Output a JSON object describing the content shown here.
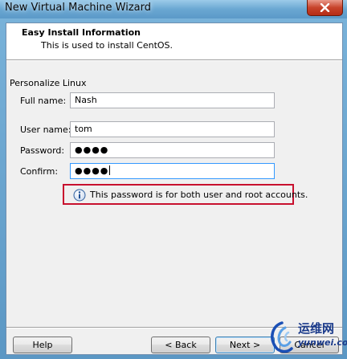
{
  "window": {
    "title": "New Virtual Machine Wizard"
  },
  "header": {
    "title": "Easy Install Information",
    "subtitle": "This is used to install CentOS."
  },
  "personalize": {
    "section_title": "Personalize Linux",
    "full_name_label": "Full name:",
    "full_name_value": "Nash",
    "user_name_label": "User name:",
    "user_name_value": "tom",
    "password_label": "Password:",
    "password_value": "●●●●",
    "confirm_label": "Confirm:",
    "confirm_value": "●●●●"
  },
  "hint": {
    "text": "This password is for both user and root accounts.",
    "highlight_color": "#c8102e"
  },
  "buttons": {
    "help": "Help",
    "back": "< Back",
    "next": "Next >",
    "cancel": "Cancel"
  },
  "watermark": {
    "line1": "运维网",
    "line2": "yunwei.com"
  },
  "icons": {
    "close": "close-icon",
    "info": "info-icon",
    "logo": "watermark-logo"
  }
}
